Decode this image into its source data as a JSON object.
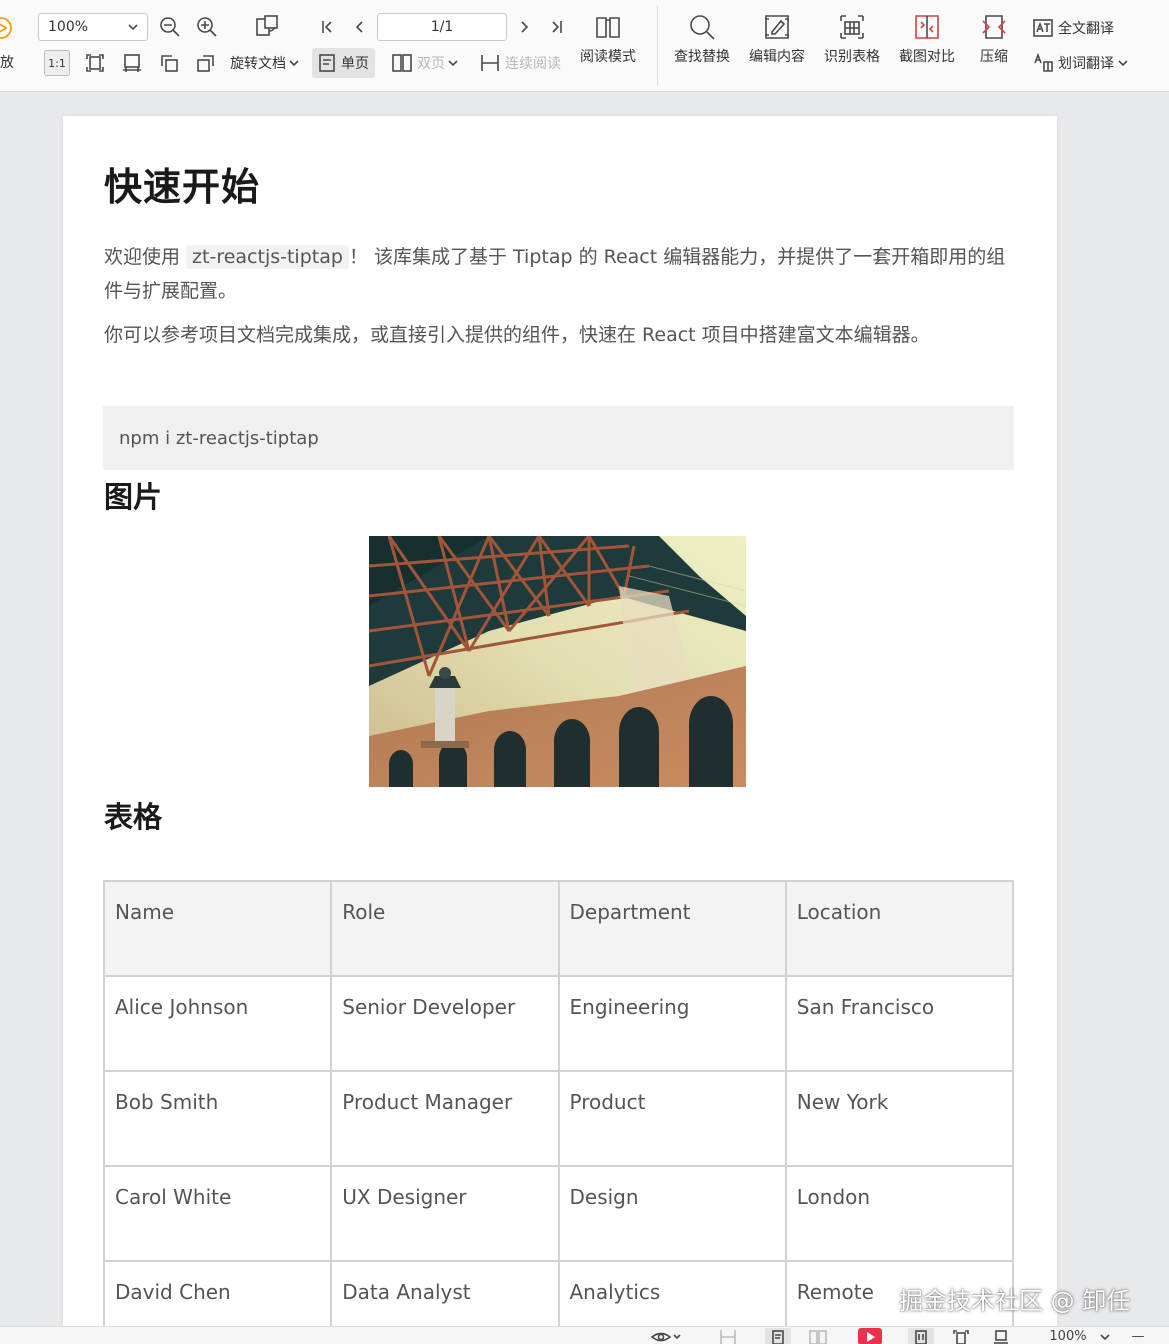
{
  "toolbar": {
    "zoom_value": "100%",
    "page_value": "1/1",
    "left_cut_label": "放",
    "rotate_label": "旋转文档",
    "single_page_label": "单页",
    "double_page_label": "双页",
    "continuous_label": "连续阅读",
    "read_mode_label": "阅读模式",
    "find_replace_label": "查找替换",
    "edit_content_label": "编辑内容",
    "recognize_table_label": "识别表格",
    "screenshot_compare_label": "截图对比",
    "compress_label": "压缩",
    "full_translate_label": "全文翻译",
    "word_translate_label": "划词翻译",
    "fit_label": "1:1"
  },
  "document": {
    "title": "快速开始",
    "intro_before": "欢迎使用 ",
    "intro_code": "zt-reactjs-tiptap",
    "intro_after": "！ 该库集成了基于 Tiptap 的 React 编辑器能力，并提供了一套开箱即用的组件与扩展配置。",
    "para2": "你可以参考项目文档完成集成，或直接引入提供的组件，快速在 React 项目中搭建富文本编辑器。",
    "code_block": "npm i zt-reactjs-tiptap",
    "image_heading": "图片",
    "table_heading": "表格",
    "table": {
      "headers": [
        "Name",
        "Role",
        "Department",
        "Location"
      ],
      "rows": [
        [
          "Alice Johnson",
          "Senior Developer",
          "Engineering",
          "San Francisco"
        ],
        [
          "Bob Smith",
          "Product Manager",
          "Product",
          "New York"
        ],
        [
          "Carol White",
          "UX Designer",
          "Design",
          "London"
        ],
        [
          "David Chen",
          "Data Analyst",
          "Analytics",
          "Remote"
        ]
      ]
    }
  },
  "statusbar": {
    "zoom_value": "100%",
    "minus": "—"
  },
  "watermark": "掘金技术社区 @ 卸任",
  "colors": {
    "toolbar_bg": "#fafafa",
    "canvas_bg": "#e8e9eb",
    "play_red": "#e8334a",
    "cut_orange": "#f39c12"
  }
}
